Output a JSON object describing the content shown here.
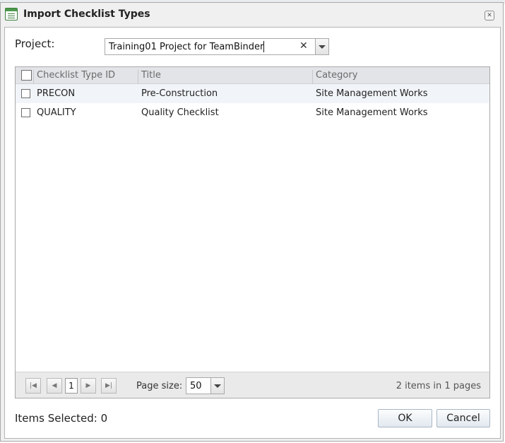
{
  "dialog": {
    "title": "Import Checklist Types"
  },
  "project": {
    "label": "Project:",
    "value": "Training01 Project for TeamBinder"
  },
  "grid": {
    "columns": [
      "Checklist Type ID",
      "Title",
      "Category"
    ],
    "rows": [
      {
        "id": "PRECON",
        "title": "Pre-Construction",
        "category": "Site Management Works",
        "checked": false
      },
      {
        "id": "QUALITY",
        "title": "Quality Checklist",
        "category": "Site Management Works",
        "checked": false
      }
    ]
  },
  "pager": {
    "current_page": "1",
    "page_size_label": "Page size:",
    "page_size": "50",
    "info": "2 items in 1 pages"
  },
  "footer": {
    "items_selected_label": "Items Selected:",
    "items_selected_count": "0",
    "ok_label": "OK",
    "cancel_label": "Cancel"
  },
  "icons": {
    "dialog": "checklist-icon",
    "close": "close-icon",
    "clear": "clear-icon",
    "dropdown": "chevron-down-icon",
    "first": "first-page-icon",
    "prev": "prev-page-icon",
    "next": "next-page-icon",
    "last": "last-page-icon"
  },
  "colors": {
    "header_bg": "#e2e4e7",
    "alt_row_bg": "#f1f5f9",
    "pager_bg": "#eaeaea",
    "button_border": "#a9b6c3"
  }
}
